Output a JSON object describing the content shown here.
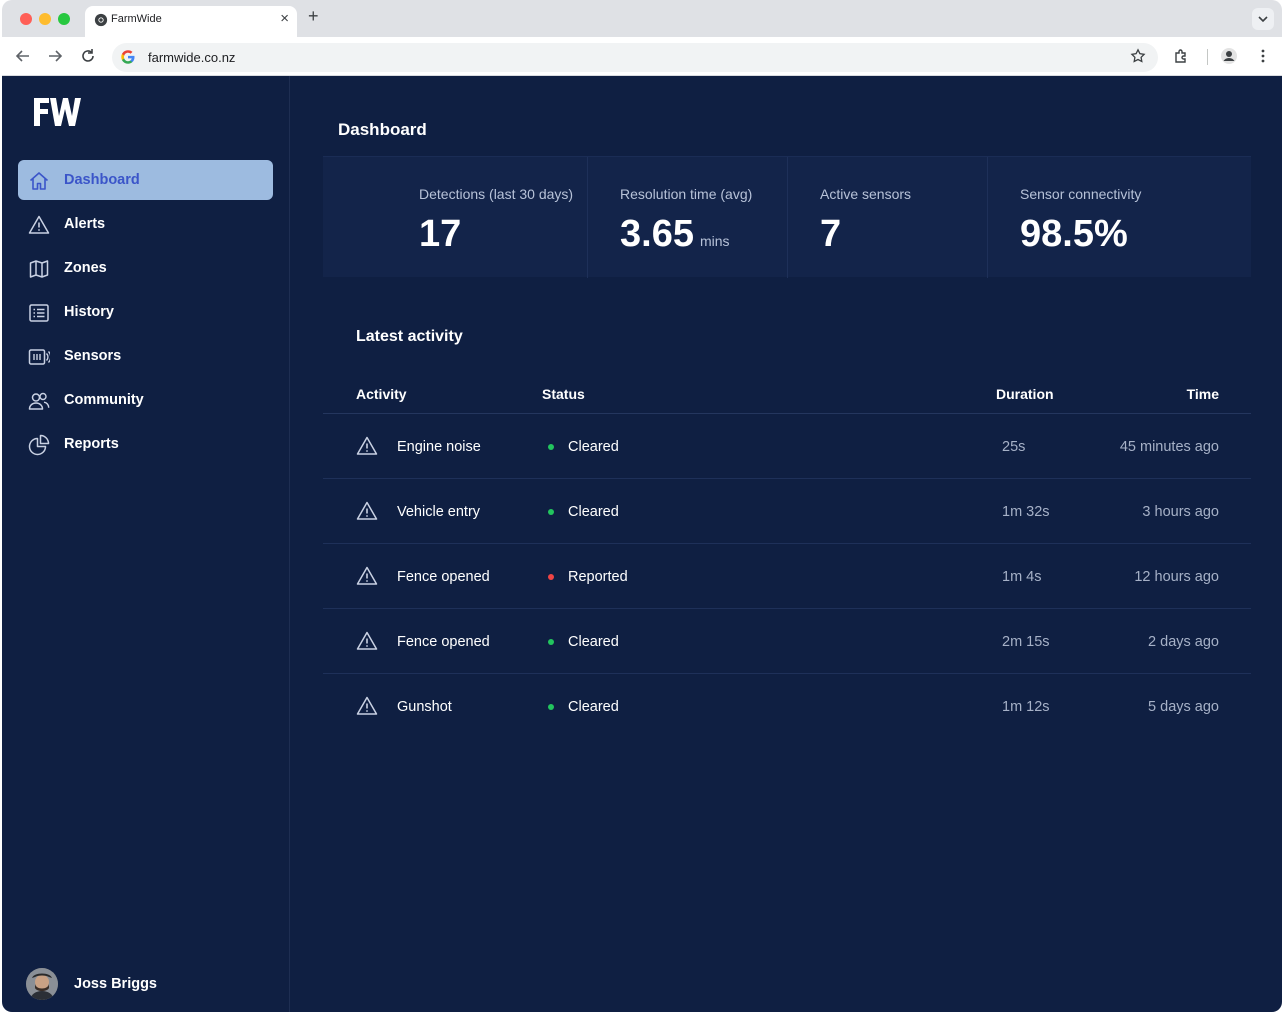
{
  "browser": {
    "tab_title": "FarmWide",
    "url": "farmwide.co.nz"
  },
  "app": {
    "logo_text": "FW",
    "nav": [
      {
        "label": "Dashboard",
        "icon": "home-icon",
        "active": true
      },
      {
        "label": "Alerts",
        "icon": "warning-icon"
      },
      {
        "label": "Zones",
        "icon": "map-icon"
      },
      {
        "label": "History",
        "icon": "list-icon"
      },
      {
        "label": "Sensors",
        "icon": "sensor-icon"
      },
      {
        "label": "Community",
        "icon": "users-icon"
      },
      {
        "label": "Reports",
        "icon": "pie-chart-icon"
      }
    ],
    "user": {
      "name": "Joss Briggs"
    }
  },
  "dashboard": {
    "title": "Dashboard",
    "stats": [
      {
        "label": "Detections (last 30 days)",
        "value": "17",
        "unit": ""
      },
      {
        "label": "Resolution time (avg)",
        "value": "3.65",
        "unit": "mins"
      },
      {
        "label": "Active sensors",
        "value": "7",
        "unit": ""
      },
      {
        "label": "Sensor connectivity",
        "value": "98.5%",
        "unit": ""
      }
    ],
    "activity": {
      "title": "Latest activity",
      "columns": [
        "Activity",
        "Status",
        "Duration",
        "Time"
      ],
      "rows": [
        {
          "activity": "Engine noise",
          "status": "Cleared",
          "duration": "25s",
          "time": "45 minutes ago"
        },
        {
          "activity": "Vehicle entry",
          "status": "Cleared",
          "duration": "1m 32s",
          "time": "3 hours ago"
        },
        {
          "activity": "Fence opened",
          "status": "Reported",
          "duration": "1m 4s",
          "time": "12 hours ago"
        },
        {
          "activity": "Fence opened",
          "status": "Cleared",
          "duration": "2m 15s",
          "time": "2 days ago"
        },
        {
          "activity": "Gunshot",
          "status": "Cleared",
          "duration": "1m 12s",
          "time": "5 days ago"
        }
      ]
    }
  },
  "colors": {
    "background": "#0f1f42",
    "nav_active_bg": "#9dbbe0",
    "nav_active_text": "#3b55c9",
    "status_cleared": "#22c55e",
    "status_reported": "#ef4444"
  }
}
